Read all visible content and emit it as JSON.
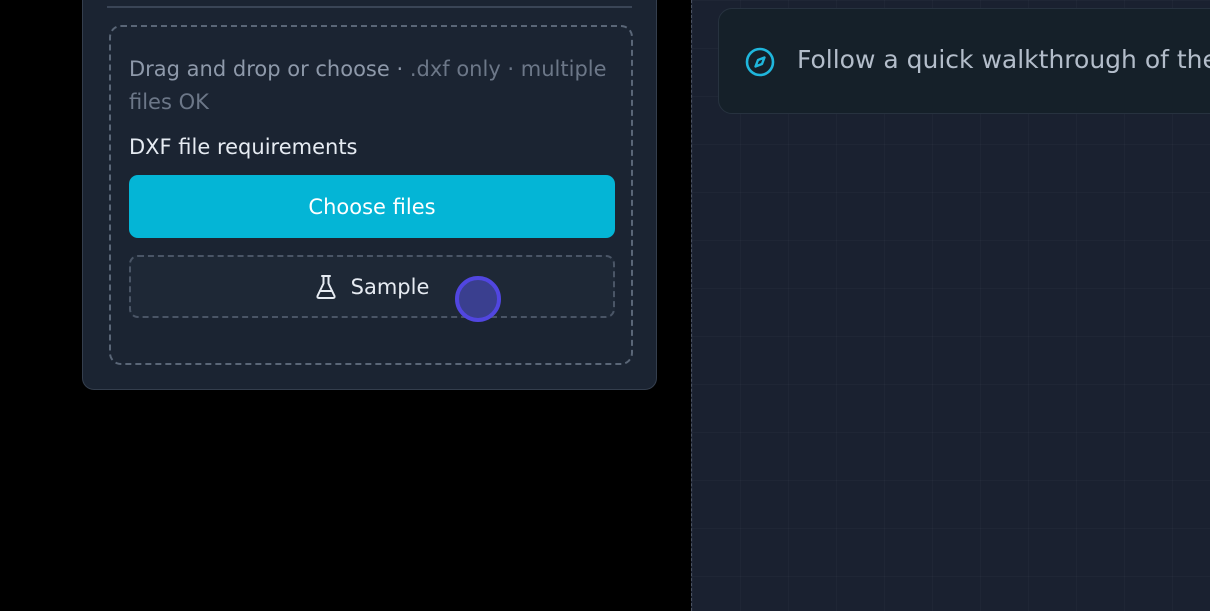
{
  "upload": {
    "hint_main": "Drag and drop or choose · ",
    "hint_ext": ".dxf only",
    "hint_rest": " · multiple files OK",
    "requirements_label": "DXF file requirements",
    "choose_label": "Choose files",
    "sample_label": "Sample"
  },
  "tour": {
    "text": "Follow a quick walkthrough of the"
  },
  "colors": {
    "accent": "#04b5d6",
    "cursor": "#5146e0",
    "panel_bg": "#1b2432",
    "canvas_bg": "#1a2130"
  },
  "icons": {
    "sample": "flask-icon",
    "tour": "compass-icon"
  }
}
